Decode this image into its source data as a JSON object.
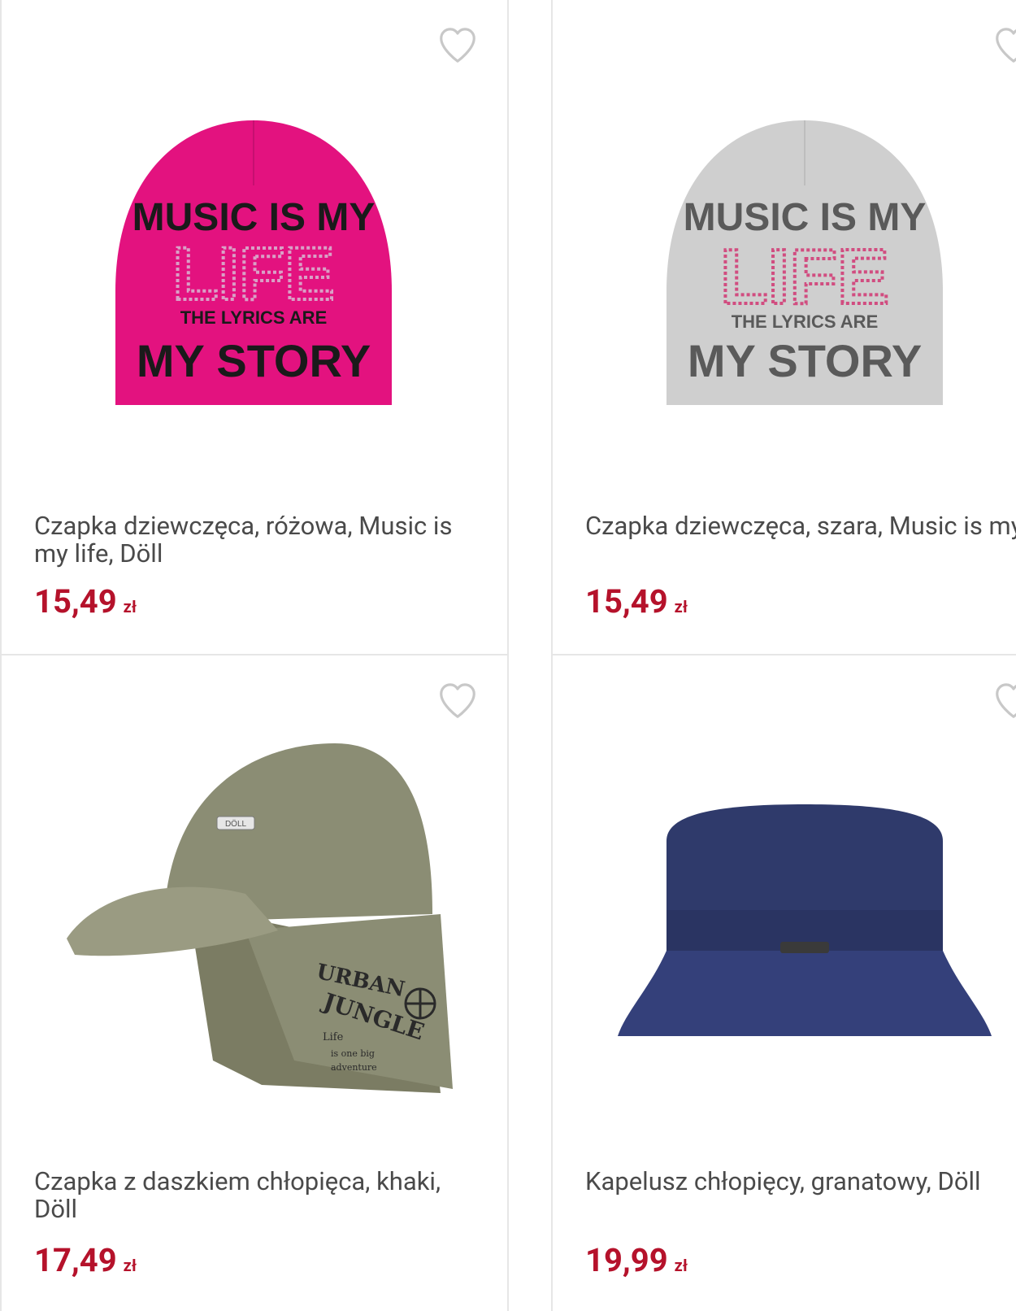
{
  "products": [
    {
      "name": "Czapka dziewczęca, różowa, Music is my life, Döll",
      "price": "15,49",
      "currency": "zł",
      "hat_color": "#e3127f",
      "print": [
        "MUSIC IS MY",
        "LIFE",
        "THE LYRICS ARE",
        "MY STORY"
      ]
    },
    {
      "name": "Czapka dziewczęca, szara, Music is my life, Döll",
      "price": "15,49",
      "currency": "zł",
      "hat_color": "#cfcfcf",
      "print": [
        "MUSIC IS MY",
        "LIFE",
        "THE LYRICS ARE",
        "MY STORY"
      ]
    },
    {
      "name": "Czapka z daszkiem chłopięca, khaki, Döll",
      "price": "17,49",
      "currency": "zł",
      "hat_color": "#8b8d74",
      "print": [
        "URBAN",
        "JUNGLE",
        "Life",
        "is one big",
        "adventure",
        "DÖLL"
      ]
    },
    {
      "name": "Kapelusz chłopięcy, granatowy, Döll",
      "price": "19,99",
      "currency": "zł",
      "hat_color": "#2f3a6b"
    }
  ],
  "icons": {
    "favorite": "heart-outline-icon"
  },
  "colors": {
    "price": "#b5122b",
    "title": "#4a4a4a",
    "card_border": "#e6e6e6",
    "heart": "#c8c8c8"
  }
}
